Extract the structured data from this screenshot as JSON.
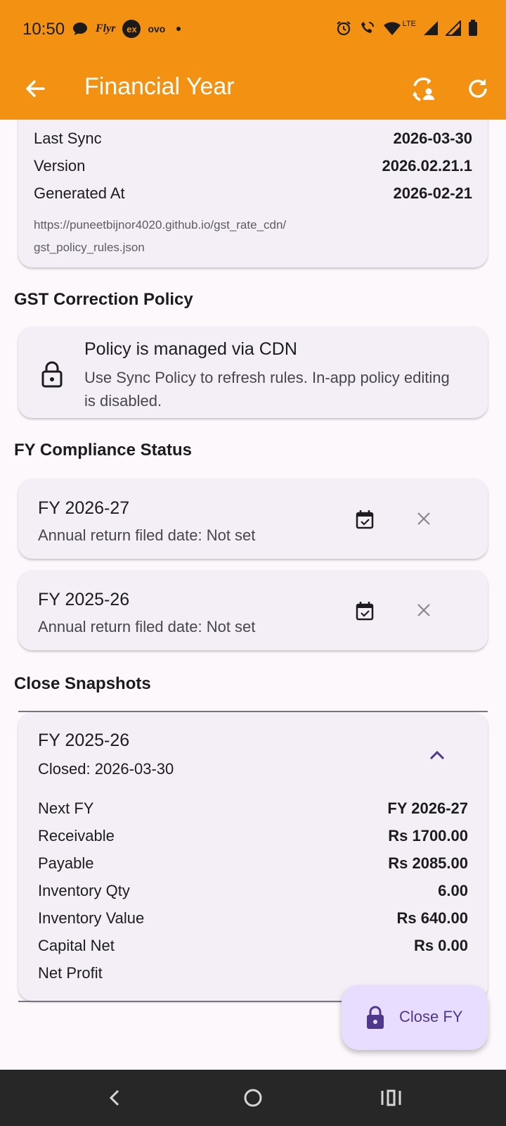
{
  "status_bar": {
    "time": "10:50",
    "left_icons": [
      "chat-bubble-icon",
      "flyr-icon",
      "ex-icon",
      "ovo-icon",
      "dot-icon"
    ],
    "flyr_text": "Flyr",
    "ex_text": "ex",
    "ovo_text": "ovo",
    "lte_text": "LTE",
    "right_icons": [
      "alarm-icon",
      "wifi-call-icon",
      "wifi-icon",
      "signal-icon",
      "signal-icon",
      "battery-icon"
    ]
  },
  "appbar": {
    "title": "Financial Year",
    "colors": {
      "bar": "#F39212",
      "text": "#FFFFFF"
    }
  },
  "sync_card": {
    "rows": [
      {
        "label": "Last Sync",
        "value": "2026-03-30"
      },
      {
        "label": "Version",
        "value": "2026.02.21.1"
      },
      {
        "label": "Generated At",
        "value": "2026-02-21"
      }
    ],
    "url_line1": "https://puneetbijnor4020.github.io/gst_rate_cdn/",
    "url_line2": "gst_policy_rules.json"
  },
  "gst_section": {
    "heading": "GST Correction Policy",
    "card_title": "Policy is managed via CDN",
    "card_subtitle": "Use Sync Policy to refresh rules. In-app policy editing is disabled."
  },
  "compliance_section": {
    "heading": "FY Compliance Status",
    "items": [
      {
        "fy": "FY 2026-27",
        "status": "Annual return filed date: Not set"
      },
      {
        "fy": "FY 2025-26",
        "status": "Annual return filed date: Not set"
      }
    ]
  },
  "snapshots_section": {
    "heading": "Close Snapshots",
    "snapshot": {
      "fy": "FY 2025-26",
      "closed": "Closed: 2026-03-30",
      "rows": [
        {
          "label": "Next FY",
          "value": "FY 2026-27"
        },
        {
          "label": "Receivable",
          "value": "Rs 1700.00"
        },
        {
          "label": "Payable",
          "value": "Rs 2085.00"
        },
        {
          "label": "Inventory Qty",
          "value": "6.00"
        },
        {
          "label": "Inventory Value",
          "value": "Rs 640.00"
        },
        {
          "label": "Capital Net",
          "value": "Rs 0.00"
        },
        {
          "label": "Net Profit",
          "value": ""
        }
      ]
    }
  },
  "fab": {
    "label": "Close FY",
    "color": "#E9DDFF",
    "accent": "#4F378B"
  }
}
